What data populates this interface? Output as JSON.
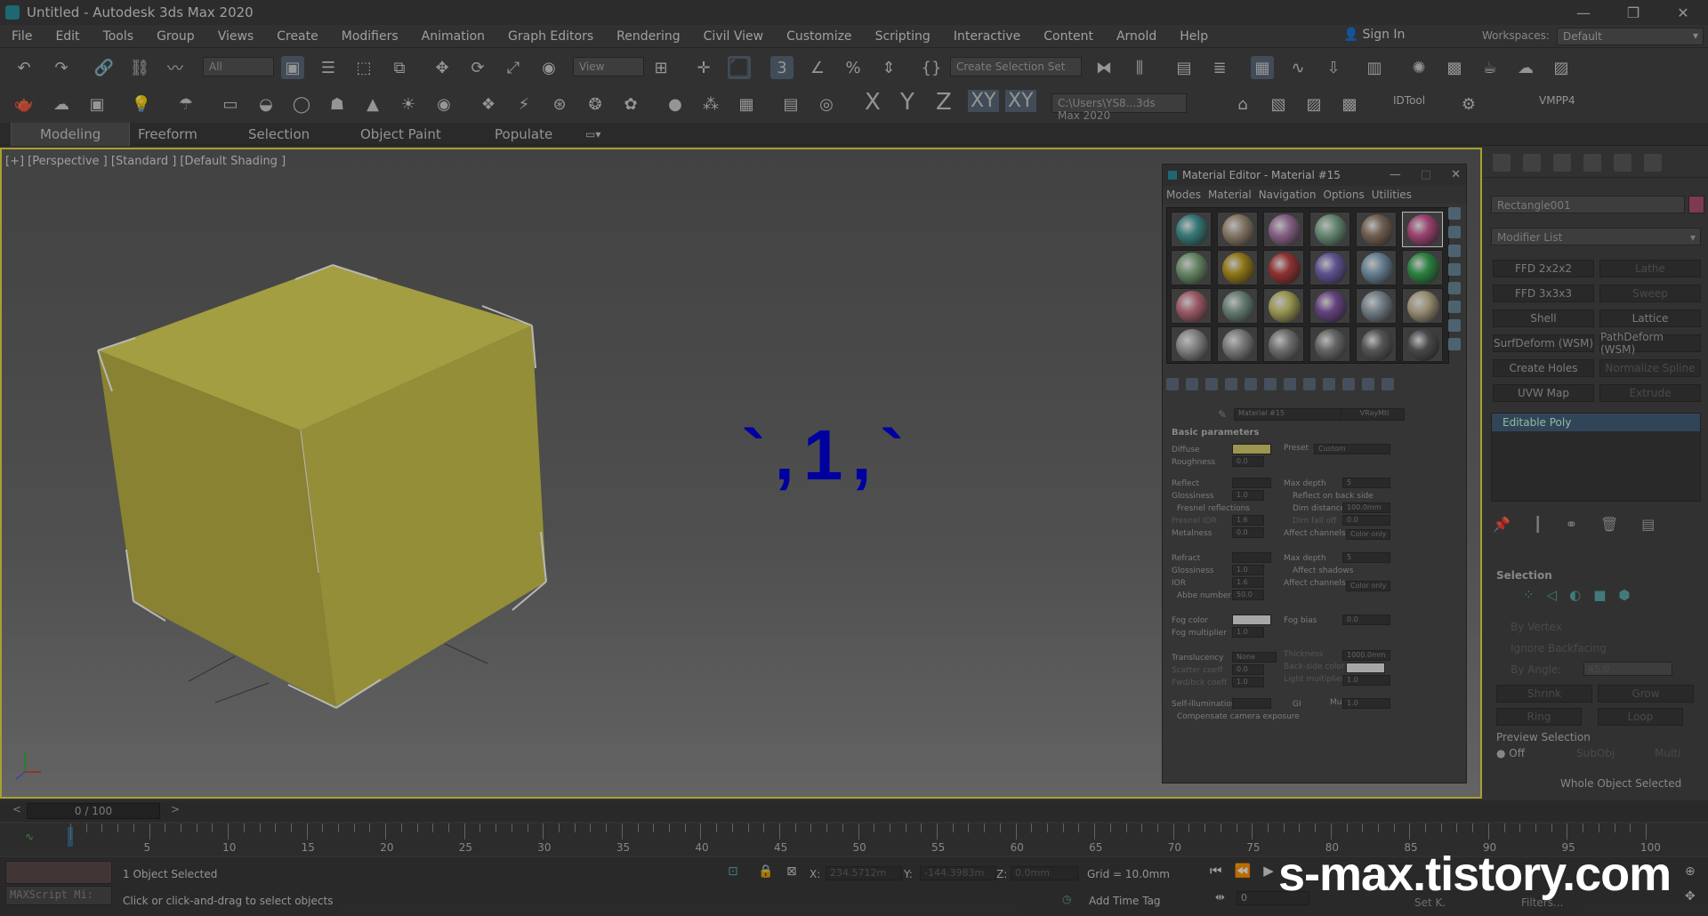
{
  "titlebar": {
    "title": "Untitled - Autodesk 3ds Max 2020",
    "minimize": "—",
    "maximize": "❐",
    "close": "✕"
  },
  "menubar": {
    "items": [
      "File",
      "Edit",
      "Tools",
      "Group",
      "Views",
      "Create",
      "Modifiers",
      "Animation",
      "Graph Editors",
      "Rendering",
      "Civil View",
      "Customize",
      "Scripting",
      "Interactive",
      "Content",
      "Arnold",
      "Help"
    ],
    "signin": "Sign In",
    "workspaces_label": "Workspaces:",
    "workspace_value": "Default"
  },
  "toolbar1": {
    "filter_value": "All",
    "ref_coord_value": "View",
    "selection_set_value": "Create Selection Set"
  },
  "toolbar2": {
    "axis_x": "X",
    "axis_y": "Y",
    "axis_z": "Z",
    "axis_xy": "XY",
    "axis_xy2": "XY",
    "path_value": "C:\\Users\\YS8...3ds Max 2020",
    "idtool": "IDTool",
    "vmpp": "VMPP4"
  },
  "ribbon": {
    "tabs": [
      "Modeling",
      "Freeform",
      "Selection",
      "Object Paint",
      "Populate"
    ]
  },
  "viewport": {
    "label": "[+] [Perspective ] [Standard ] [Default Shading ]",
    "overlay": "`,1,`"
  },
  "material_editor": {
    "title": "Material Editor - Material #15",
    "menu": [
      "Modes",
      "Material",
      "Navigation",
      "Options",
      "Utilities"
    ],
    "slot_colors": [
      "#4aa6a6",
      "#b8a28c",
      "#b884b8",
      "#8cba9c",
      "#9c8470",
      "#d45c9a",
      "#8cba8c",
      "#c8a420",
      "#c84444",
      "#8470c8",
      "#8cb0c8",
      "#3cb45a",
      "#d87c8c",
      "#8cac9c",
      "#d4d070",
      "#8c5cb0",
      "#9cacb8",
      "#d4c4a0",
      "#b4b4b4",
      "#a8a8a8",
      "#999999",
      "#8c8c8c",
      "#777777",
      "#666666"
    ],
    "material_name": "Material #15",
    "material_type": "VRayMtl",
    "section": "Basic parameters",
    "labels": {
      "diffuse": "Diffuse",
      "preset": "Preset",
      "preset_value": "Custom",
      "roughness": "Roughness",
      "roughness_v": "0.0",
      "reflect": "Reflect",
      "max_depth": "Max depth",
      "max_depth_v": "5",
      "glossiness": "Glossiness",
      "glossiness_v": "1.0",
      "reflect_back": "Reflect on back side",
      "fresnel": "Fresnel reflections",
      "dim_distance": "Dim distance",
      "dim_distance_v": "100.0mm",
      "fresnel_ior": "Fresnel IOR",
      "fresnel_ior_v": "1.6",
      "dim_falloff": "Dim fall off",
      "dim_falloff_v": "0.0",
      "metalness": "Metalness",
      "metalness_v": "0.0",
      "affect_channels": "Affect channels",
      "color_only": "Color only",
      "refract": "Refract",
      "max_depth2_v": "5",
      "glossiness2_v": "1.0",
      "affect_shadows": "Affect shadows",
      "ior": "IOR",
      "ior_v": "1.6",
      "abbe": "Abbe number",
      "abbe_v": "50.0",
      "fog_color": "Fog color",
      "fog_bias": "Fog bias",
      "fog_bias_v": "0.0",
      "fog_mult": "Fog multiplier",
      "fog_mult_v": "1.0",
      "translucency": "Translucency",
      "translucency_v": "None",
      "thickness": "Thickness",
      "thickness_v": "1000.0mm",
      "scatter_coeff": "Scatter coeff",
      "scatter_coeff_v": "0.0",
      "back_side_color": "Back-side color",
      "fwd_bck_coeff": "Fwd/bck coeff",
      "fwd_bck_coeff_v": "1.0",
      "light_multiplier": "Light multiplier",
      "light_multiplier_v": "1.0",
      "self_illum": "Self-illumination",
      "gi": "GI",
      "mult": "Mult",
      "mult_v": "1.0",
      "compensate": "Compensate camera exposure"
    },
    "colors": {
      "diffuse": "#d8d070",
      "reflect": "#3a3a3a",
      "refract": "#3a3a3a",
      "fog": "#e8e8e8",
      "backside": "#e8e8e8",
      "selfillum": "#3a3a3a"
    }
  },
  "command_panel": {
    "object_name": "Rectangle001",
    "modifier_list": "Modifier List",
    "buttons": [
      [
        "FFD 2x2x2",
        "Lathe"
      ],
      [
        "FFD 3x3x3",
        "Sweep"
      ],
      [
        "Shell",
        "Lattice"
      ],
      [
        "SurfDeform (WSM)",
        "PathDeform (WSM)"
      ],
      [
        "Create Holes",
        "Normalize Spline"
      ],
      [
        "UVW Map",
        "Extrude"
      ]
    ],
    "stack_item": "Editable Poly",
    "selection_title": "Selection",
    "by_vertex": "By Vertex",
    "ignore_backfacing": "Ignore Backfacing",
    "by_angle": "By Angle:",
    "by_angle_v": "45.0",
    "shrink": "Shrink",
    "grow": "Grow",
    "ring": "Ring",
    "loop": "Loop",
    "preview_selection": "Preview Selection",
    "off": "Off",
    "subobj": "SubObj",
    "multi": "Multi",
    "whole_object": "Whole Object Selected"
  },
  "timeline": {
    "frame": "0 / 100",
    "ticks": [
      "5",
      "10",
      "15",
      "20",
      "25",
      "30",
      "35",
      "40",
      "45",
      "50",
      "55",
      "60",
      "65",
      "70",
      "75",
      "80",
      "85",
      "90",
      "95",
      "100"
    ]
  },
  "status": {
    "maxscript": "MAXScript Mi:",
    "selected": "1 Object Selected",
    "prompt": "Click or click-and-drag to select objects",
    "x_label": "X:",
    "x_value": "234.5712m",
    "y_label": "Y:",
    "y_value": "-144.3983m",
    "z_label": "Z:",
    "z_value": "0.0mm",
    "grid": "Grid = 10.0mm",
    "add_time_tag": "Add Time Tag",
    "frame_field": "0",
    "set_k": "Set K.",
    "filters": "Filters..."
  },
  "watermark": "s-max.tistory.com"
}
